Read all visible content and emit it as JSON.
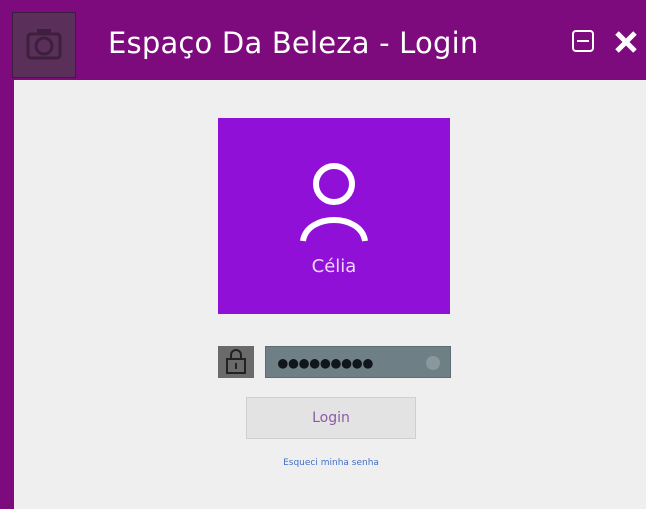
{
  "window": {
    "title": "Espaço Da Beleza - Login",
    "icons": {
      "app": "camera-icon",
      "minimize": "minimize-icon",
      "close": "close-icon"
    }
  },
  "user": {
    "name": "Célia",
    "icon": "user-icon"
  },
  "password": {
    "masked_value": "●●●●●●●●●",
    "lock_icon": "lock-icon",
    "eye_icon": "eye-icon"
  },
  "login": {
    "button_label": "Login",
    "forgot_link": "Esqueci minha senha"
  },
  "colors": {
    "frame": "#7d0b7d",
    "tile": "#9010d8",
    "content_bg": "#efefef"
  }
}
